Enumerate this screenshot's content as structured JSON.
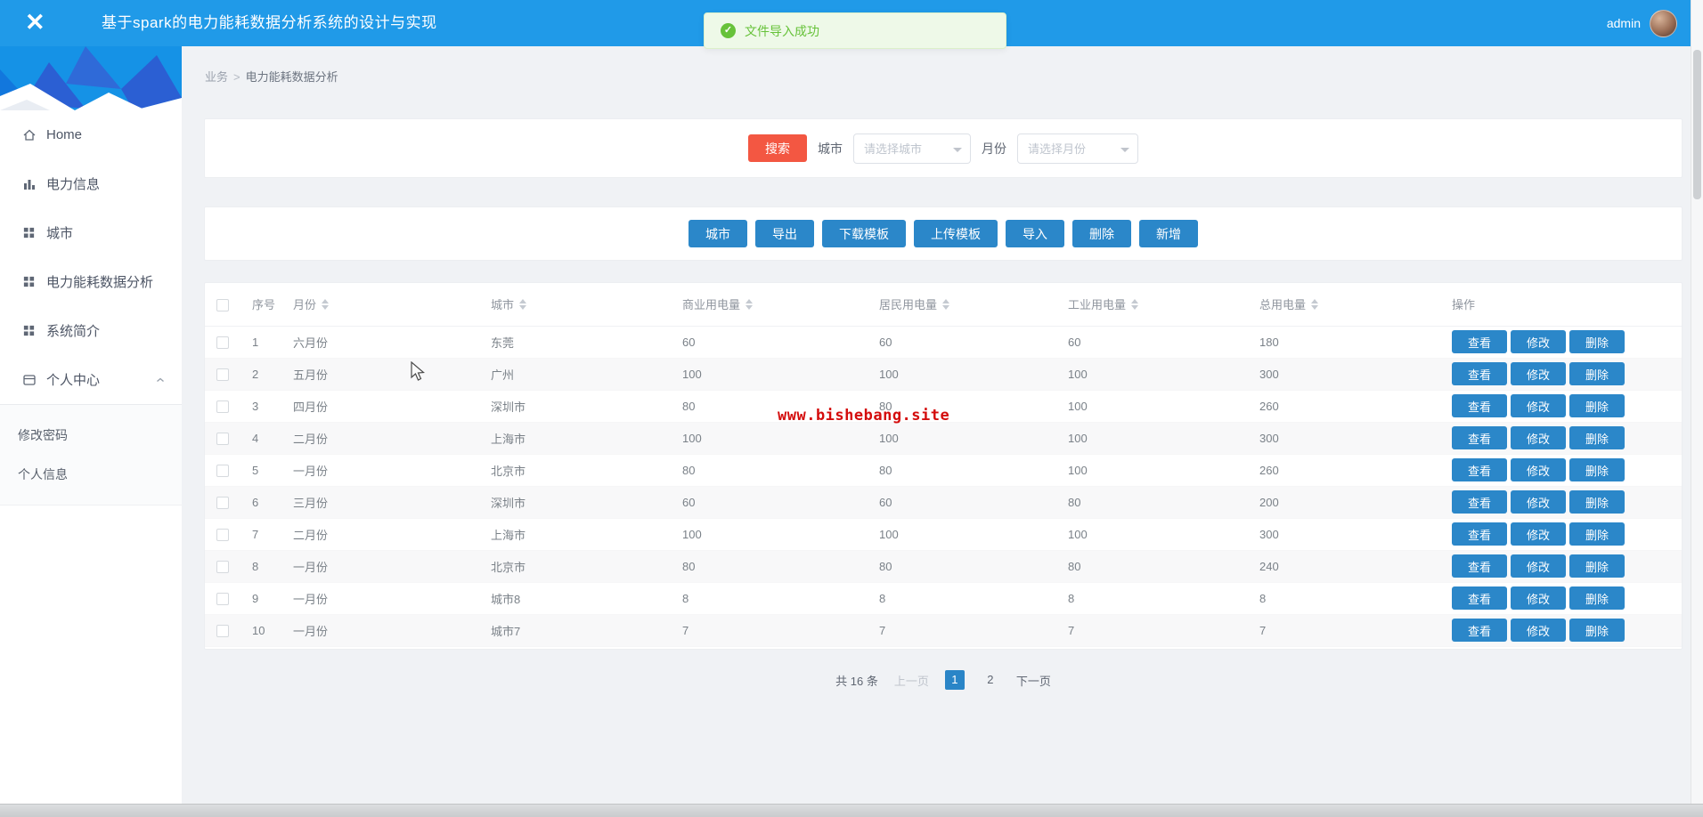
{
  "header": {
    "logo": "✕",
    "title": "基于spark的电力能耗数据分析系统的设计与实现",
    "username": "admin"
  },
  "toast": {
    "icon": "check-circle",
    "message": "文件导入成功"
  },
  "breadcrumb": {
    "section": "业务",
    "separator": ">",
    "page": "电力能耗数据分析"
  },
  "sidebar": {
    "items": [
      {
        "label": "Home",
        "icon": "home-icon"
      },
      {
        "label": "电力信息",
        "icon": "bar-chart-icon"
      },
      {
        "label": "城市",
        "icon": "grid-icon"
      },
      {
        "label": "电力能耗数据分析",
        "icon": "grid-icon"
      },
      {
        "label": "系统简介",
        "icon": "grid-icon"
      },
      {
        "label": "个人中心",
        "icon": "id-card-icon",
        "expanded": true
      }
    ],
    "subitems": [
      {
        "label": "修改密码"
      },
      {
        "label": "个人信息"
      }
    ]
  },
  "search": {
    "search_button": "搜索",
    "city_label": "城市",
    "city_placeholder": "请选择城市",
    "month_label": "月份",
    "month_placeholder": "请选择月份"
  },
  "toolbar": {
    "buttons": [
      "城市",
      "导出",
      "下载模板",
      "上传模板",
      "导入",
      "删除",
      "新增"
    ]
  },
  "table": {
    "columns": [
      "序号",
      "月份",
      "城市",
      "商业用电量",
      "居民用电量",
      "工业用电量",
      "总用电量",
      "操作"
    ],
    "row_actions": [
      "查看",
      "修改",
      "删除"
    ],
    "rows": [
      {
        "index": "1",
        "month": "六月份",
        "city": "东莞",
        "commercial": "60",
        "resident": "60",
        "industrial": "60",
        "total": "180"
      },
      {
        "index": "2",
        "month": "五月份",
        "city": "广州",
        "commercial": "100",
        "resident": "100",
        "industrial": "100",
        "total": "300"
      },
      {
        "index": "3",
        "month": "四月份",
        "city": "深圳市",
        "commercial": "80",
        "resident": "80",
        "industrial": "100",
        "total": "260"
      },
      {
        "index": "4",
        "month": "二月份",
        "city": "上海市",
        "commercial": "100",
        "resident": "100",
        "industrial": "100",
        "total": "300"
      },
      {
        "index": "5",
        "month": "一月份",
        "city": "北京市",
        "commercial": "80",
        "resident": "80",
        "industrial": "100",
        "total": "260"
      },
      {
        "index": "6",
        "month": "三月份",
        "city": "深圳市",
        "commercial": "60",
        "resident": "60",
        "industrial": "80",
        "total": "200"
      },
      {
        "index": "7",
        "month": "二月份",
        "city": "上海市",
        "commercial": "100",
        "resident": "100",
        "industrial": "100",
        "total": "300"
      },
      {
        "index": "8",
        "month": "一月份",
        "city": "北京市",
        "commercial": "80",
        "resident": "80",
        "industrial": "80",
        "total": "240"
      },
      {
        "index": "9",
        "month": "一月份",
        "city": "城市8",
        "commercial": "8",
        "resident": "8",
        "industrial": "8",
        "total": "8"
      },
      {
        "index": "10",
        "month": "一月份",
        "city": "城市7",
        "commercial": "7",
        "resident": "7",
        "industrial": "7",
        "total": "7"
      }
    ]
  },
  "pagination": {
    "total_text": "共 16 条",
    "prev": "上一页",
    "pages": [
      "1",
      "2"
    ],
    "active_page": "1",
    "next": "下一页"
  },
  "watermark": "www.bishebang.site",
  "colors": {
    "header_blue": "#209ae8",
    "primary_button_blue": "#2b87c9",
    "search_button_red": "#f35742",
    "toast_green": "#67c23a",
    "pagination_active_blue": "#2a85c7",
    "watermark_red": "#d40c0c",
    "content_background": "#f0f2f5"
  }
}
